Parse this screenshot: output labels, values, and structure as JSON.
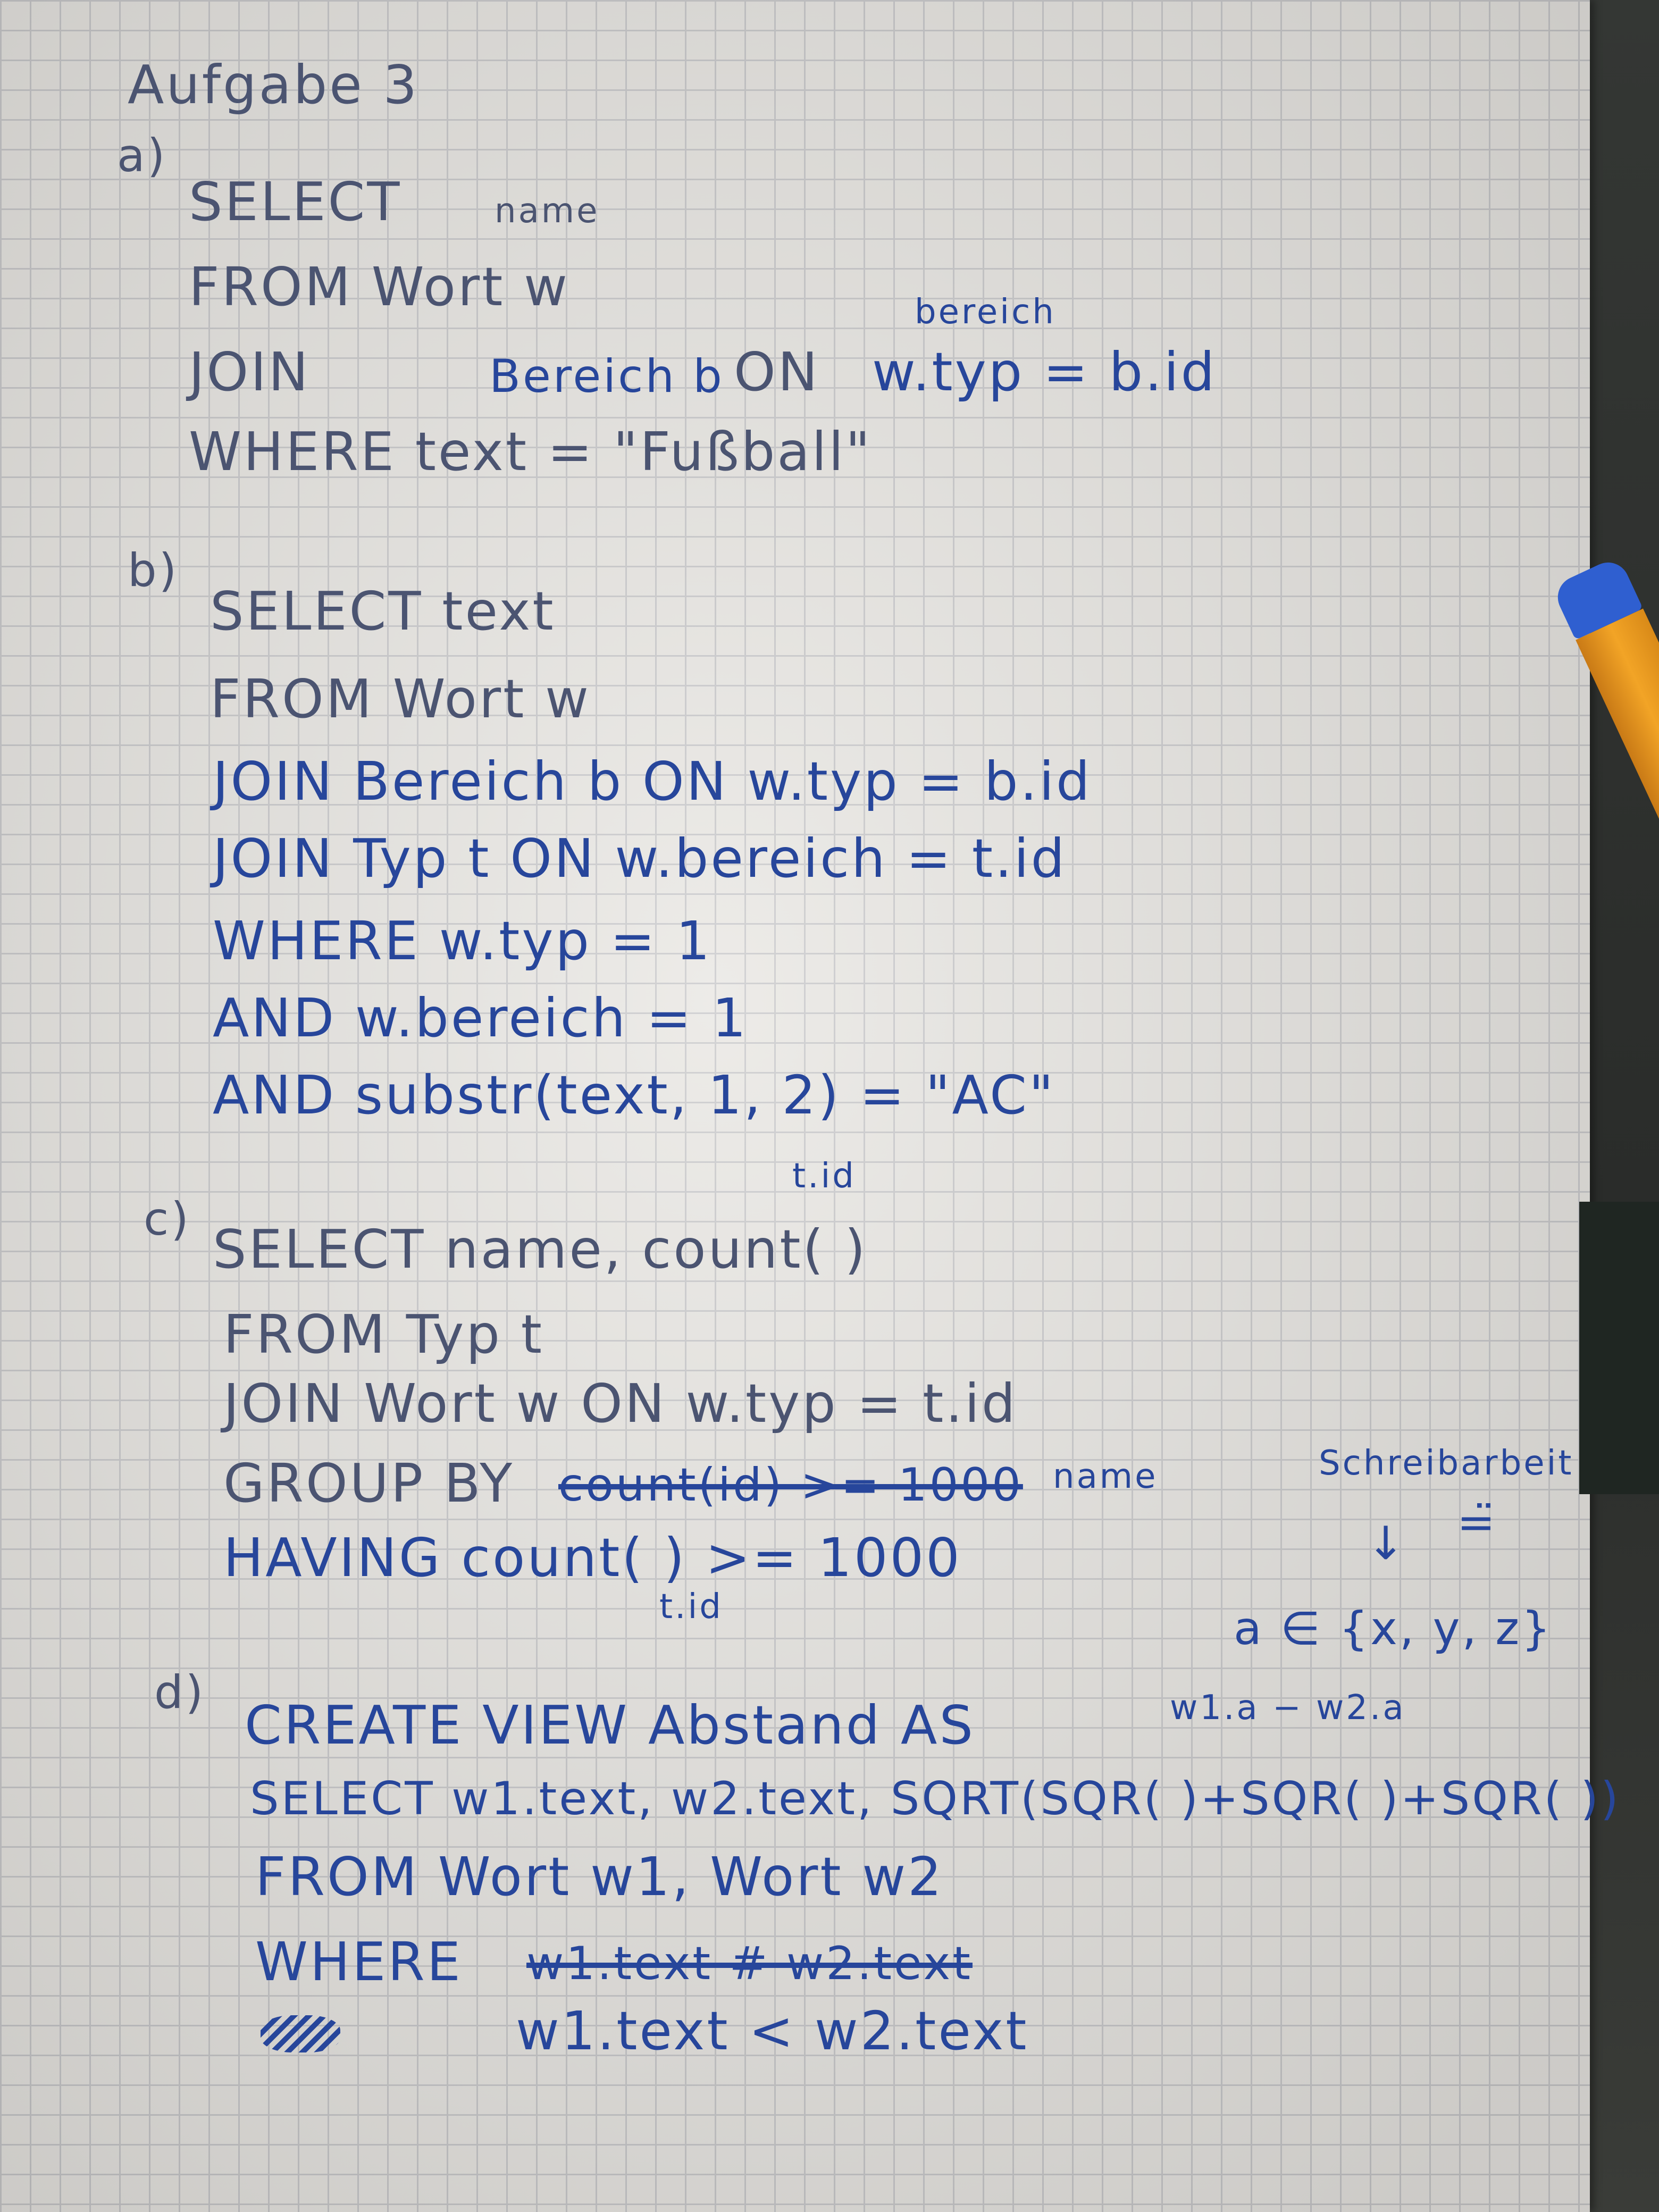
{
  "title": "Aufgabe 3",
  "a": {
    "label": "a)",
    "select": "SELECT",
    "select_col": "name",
    "from": "FROM Wort w",
    "join_kw": "JOIN",
    "join_table": "Bereich b",
    "on_kw": "ON",
    "on_cond": "w.typ = b.id",
    "insert": "bereich",
    "where": "WHERE text = \"Fußball\""
  },
  "b": {
    "label": "b)",
    "lines": [
      "SELECT text",
      "FROM Wort w",
      "JOIN Bereich b ON w.typ = b.id",
      "JOIN Typ t ON w.bereich = t.id",
      "WHERE w.typ = 1",
      "AND w.bereich = 1",
      "AND substr(text, 1, 2) = \"AC\""
    ]
  },
  "c": {
    "label": "c)",
    "insert_top": "t.id",
    "select": "SELECT name, count( )",
    "from": "FROM Typ t",
    "join": "JOIN Wort w ON w.typ = t.id",
    "group_kw": "GROUP BY",
    "group_struck": "count(id) >= 1000",
    "group_col": "name",
    "having": "HAVING count( ) >= 1000",
    "insert_bottom": "t.id"
  },
  "d": {
    "label": "d)",
    "create": "CREATE VIEW Abstand AS",
    "select": "SELECT w1.text, w2.text, SQRT(SQR( )+SQR( )+SQR( ))",
    "from": "FROM Wort w1, Wort w2",
    "where": "WHERE",
    "where_struck": "w1.text # w2.text",
    "cond": "w1.text <  w2.text"
  },
  "side_note": {
    "word": "Schreibarbeit",
    "symbol": "=̈",
    "arrow": "↓",
    "set": "a ∈ {x, y, z}",
    "diff": "w1.a − w2.a"
  }
}
